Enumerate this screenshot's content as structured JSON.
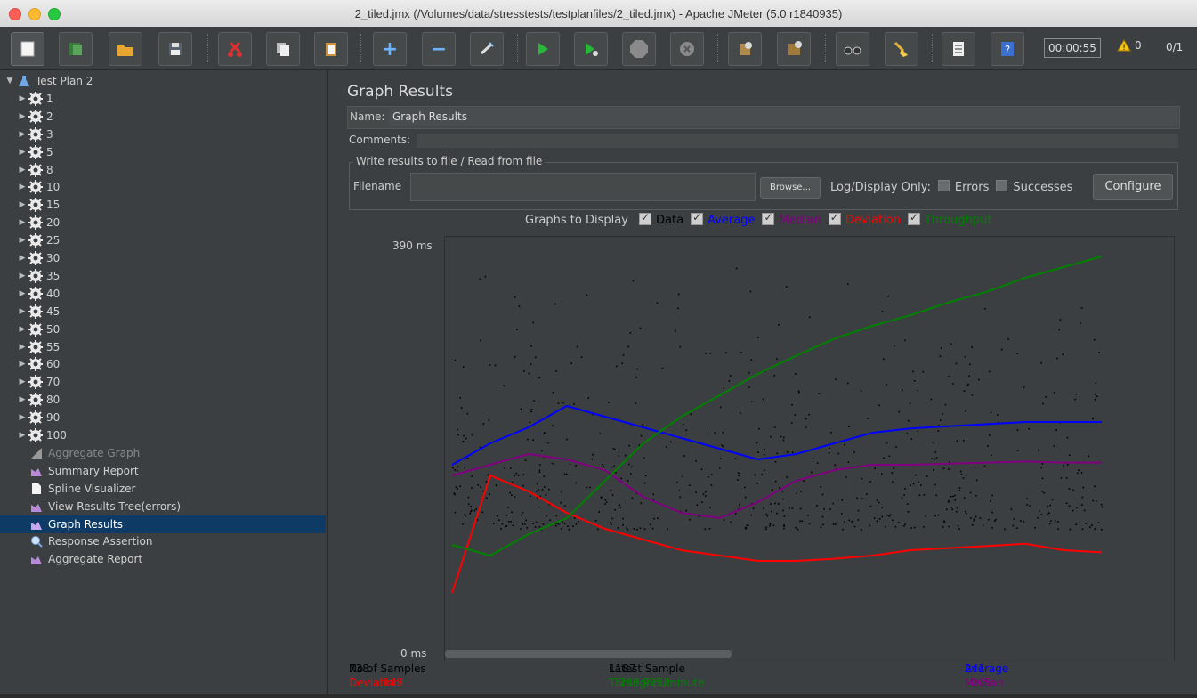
{
  "window": {
    "title": "2_tiled.jmx (/Volumes/data/stresstests/testplanfiles/2_tiled.jmx) - Apache JMeter (5.0 r1840935)"
  },
  "toolbar": {
    "buttons": [
      "new",
      "templates",
      "open",
      "save",
      "cut",
      "copy",
      "paste",
      "expand",
      "collapse",
      "toggle",
      "start",
      "start-no-pauses",
      "stop",
      "shutdown",
      "clear",
      "clear-all",
      "search",
      "reset-search",
      "function-helper",
      "help"
    ],
    "timer": "00:00:55",
    "warnings": "0",
    "threads": "0/1"
  },
  "tree": {
    "root": "Test Plan 2",
    "groups": [
      "1",
      "2",
      "3",
      "5",
      "8",
      "10",
      "15",
      "20",
      "25",
      "30",
      "35",
      "40",
      "45",
      "50",
      "55",
      "60",
      "70",
      "80",
      "90",
      "100"
    ],
    "listeners": [
      {
        "label": "Aggregate Graph",
        "dim": true
      },
      {
        "label": "Summary Report",
        "dim": false
      },
      {
        "label": "Spline Visualizer",
        "dim": false
      },
      {
        "label": "View Results Tree(errors)",
        "dim": false
      },
      {
        "label": "Graph Results",
        "selected": true
      },
      {
        "label": "Response Assertion",
        "dim": false
      },
      {
        "label": "Aggregate Report",
        "dim": false
      }
    ]
  },
  "panel": {
    "heading": "Graph Results",
    "name_label": "Name:",
    "name_value": "Graph Results",
    "comments_label": "Comments:",
    "file_legend": "Write results to file / Read from file",
    "filename_label": "Filename",
    "browse": "Browse...",
    "log_display": "Log/Display Only:",
    "errors": "Errors",
    "successes": "Successes",
    "configure": "Configure",
    "graphs_to_display": "Graphs to Display",
    "toggles": [
      {
        "label": "Data",
        "color": "#000000"
      },
      {
        "label": "Average",
        "color": "#0000ff"
      },
      {
        "label": "Median",
        "color": "#800080"
      },
      {
        "label": "Deviation",
        "color": "#ff0000"
      },
      {
        "label": "Throughput",
        "color": "#008000"
      }
    ]
  },
  "chart_data": {
    "type": "line",
    "y_top": "390 ms",
    "y_bottom": "0 ms",
    "ylim": [
      0,
      390
    ],
    "series": [
      {
        "name": "Average",
        "color": "#0000ff",
        "values": [
          180,
          200,
          215,
          235,
          225,
          215,
          205,
          195,
          185,
          190,
          200,
          210,
          214,
          216,
          218,
          220,
          220,
          220
        ]
      },
      {
        "name": "Median",
        "color": "#800080",
        "values": [
          170,
          180,
          190,
          185,
          175,
          150,
          135,
          130,
          145,
          165,
          175,
          180,
          180,
          181,
          182,
          183,
          182,
          182
        ]
      },
      {
        "name": "Deviation",
        "color": "#ff0000",
        "values": [
          60,
          170,
          155,
          135,
          120,
          110,
          100,
          95,
          90,
          90,
          92,
          95,
          100,
          102,
          104,
          106,
          100,
          98
        ]
      },
      {
        "name": "Throughput",
        "color": "#008000",
        "values": [
          105,
          95,
          115,
          130,
          165,
          200,
          225,
          245,
          265,
          282,
          298,
          310,
          320,
          332,
          342,
          355,
          365,
          375
        ]
      }
    ]
  },
  "stats": {
    "no_samples_label": "No of Samples",
    "no_samples": "738",
    "latest_label": "Latest Sample",
    "latest": "1187",
    "average_label": "Average",
    "average": "241",
    "deviation_label": "Deviation",
    "deviation": "143",
    "throughput_label": "Throughput",
    "throughput": "798.975/minute",
    "median_label": "Median",
    "median": "205"
  }
}
